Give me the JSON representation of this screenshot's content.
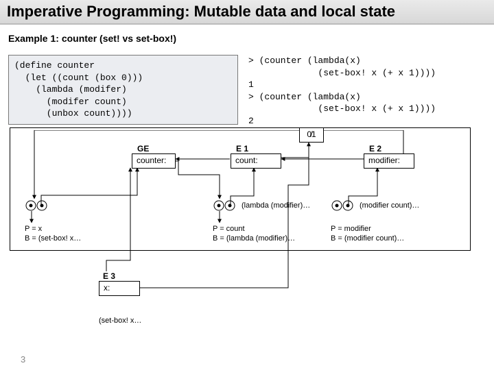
{
  "title": "Imperative Programming:   Mutable data and local state",
  "subtitle": "Example 1: counter (set! vs set-box!)",
  "code_left": "(define counter\n  (let ((count (box 0)))\n    (lambda (modifer)\n      (modifer count)\n      (unbox count))))",
  "code_right": "> (counter (lambda(x)\n             (set-box! x (+ x 1))))\n1\n> (counter (lambda(x)\n             (set-box! x (+ x 1))))\n2",
  "diagram": {
    "ge_label": "GE",
    "ge_content": "counter:",
    "e1_label": "E 1",
    "e1_content": "count:",
    "e2_label": "E 2",
    "e2_content": "modifier:",
    "e3_label": "E 3",
    "e3_content": "x:",
    "closure1_p": "P = x",
    "closure1_b": "B = (set-box! x…",
    "closure2_text": "(lambda (modifier)…",
    "closure2_p": "P = count",
    "closure2_b": "B = (lambda (modifier)…",
    "closure3_text": "(modifier count)…",
    "closure3_p": "P = modifier",
    "closure3_b": "B = (modifier  count)…",
    "bottom_text": "(set-box! x…",
    "box01": "0̸1"
  },
  "page_number": "3"
}
